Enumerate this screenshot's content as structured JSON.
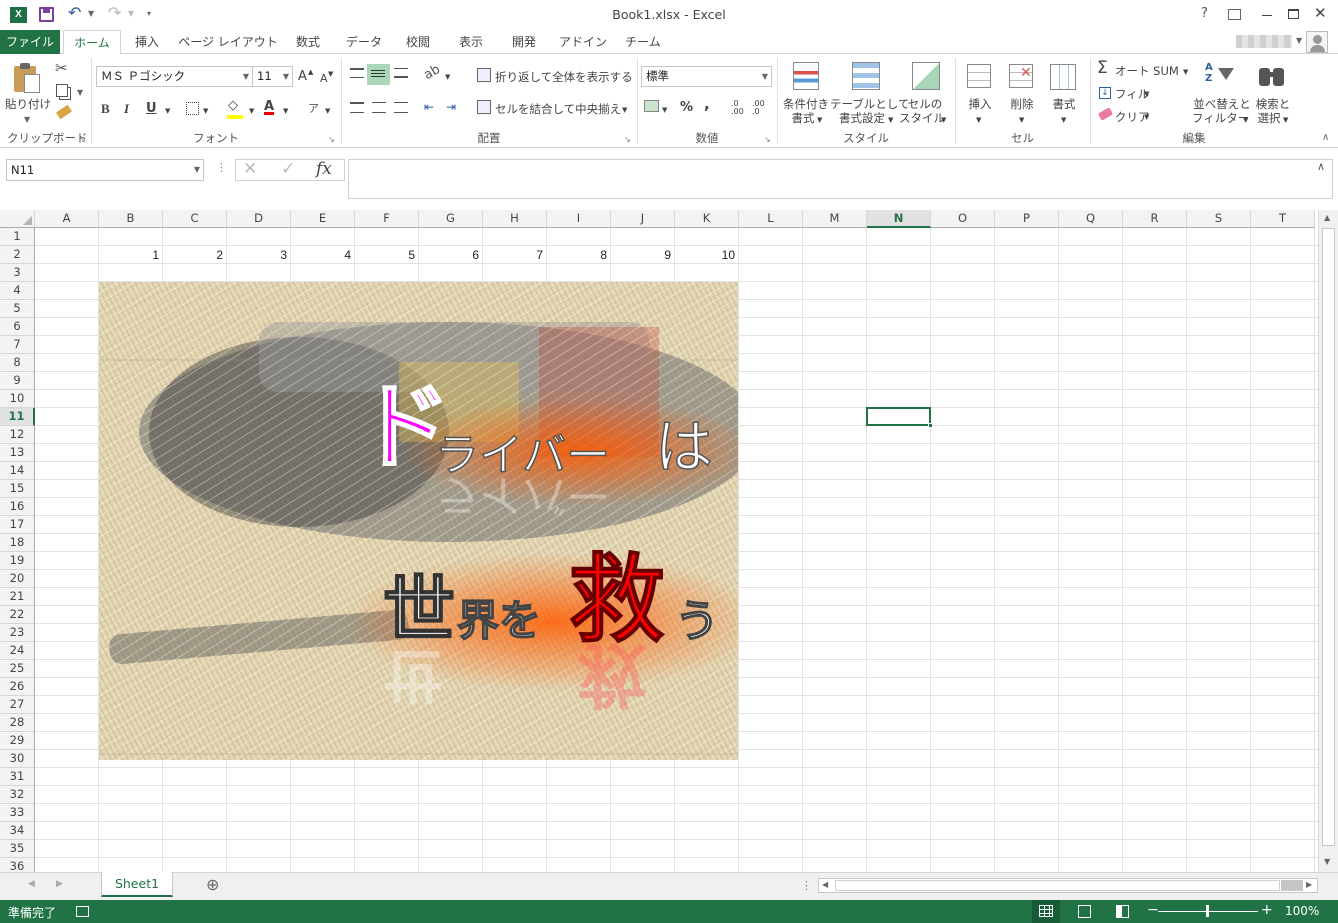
{
  "window": {
    "title": "Book1.xlsx - Excel",
    "help_label": "?"
  },
  "quick_access": {
    "app_icon": "excel-icon",
    "save_icon": "save-icon",
    "undo_icon": "undo-icon",
    "redo_icon": "redo-icon"
  },
  "tabs": [
    "ファイル",
    "ホーム",
    "挿入",
    "ページ レイアウト",
    "数式",
    "データ",
    "校閲",
    "表示",
    "開発",
    "アドイン",
    "チーム"
  ],
  "active_tab": "ホーム",
  "ribbon": {
    "clipboard": {
      "paste": "貼り付け",
      "label": "クリップボード"
    },
    "font": {
      "name": "ＭＳ Ｐゴシック",
      "size": "11",
      "bold": "B",
      "italic": "I",
      "underline": "U",
      "grow": "A",
      "shrink": "A",
      "font_color_letter": "A",
      "label": "フォント"
    },
    "alignment": {
      "wrap": "折り返して全体を表示する",
      "merge": "セルを結合して中央揃え",
      "label": "配置"
    },
    "number": {
      "format": "標準",
      "percent": "%",
      "comma": ",",
      "label": "数値"
    },
    "styles": {
      "conditional": [
        "条件付き",
        "書式"
      ],
      "table": [
        "テーブルとして",
        "書式設定"
      ],
      "cell": [
        "セルの",
        "スタイル"
      ],
      "label": "スタイル"
    },
    "cells": {
      "insert": "挿入",
      "delete": "削除",
      "format": "書式",
      "label": "セル"
    },
    "editing": {
      "autosum": "オート SUM",
      "fill": "フィル",
      "clear": "クリア",
      "sort": [
        "並べ替えと",
        "フィルター"
      ],
      "find": [
        "検索と",
        "選択"
      ],
      "label": "編集"
    }
  },
  "formula_bar": {
    "name_box": "N11",
    "cancel": "✕",
    "enter": "✓",
    "fx": "fx",
    "value": ""
  },
  "grid": {
    "columns": [
      "A",
      "B",
      "C",
      "D",
      "E",
      "F",
      "G",
      "H",
      "I",
      "J",
      "K",
      "L",
      "M",
      "N",
      "O",
      "P",
      "Q",
      "R",
      "S",
      "T"
    ],
    "rows": [
      "1",
      "2",
      "3",
      "4",
      "5",
      "6",
      "7",
      "8",
      "9",
      "10",
      "11",
      "12",
      "13",
      "14",
      "15",
      "16",
      "17",
      "18",
      "19",
      "20",
      "21",
      "22",
      "23",
      "24",
      "25",
      "26",
      "27",
      "28",
      "29",
      "30",
      "31",
      "32",
      "33",
      "34",
      "35",
      "36"
    ],
    "active_column": "N",
    "active_row": "11",
    "row2_values": [
      "1",
      "2",
      "3",
      "4",
      "5",
      "6",
      "7",
      "8",
      "9",
      "10"
    ]
  },
  "picture": {
    "line1_big": "ド",
    "line1_rest": "ライバー",
    "line1_end": "は",
    "line2_a": "世",
    "line2_b": "界を",
    "line2_c": "救",
    "line2_d": "う",
    "colors": {
      "magenta": "#ff00ff",
      "red": "#ff0000",
      "white": "#ffffff",
      "glow": "#ff6a00"
    }
  },
  "sheet_tabs": [
    "Sheet1"
  ],
  "add_sheet": "⊕",
  "status": {
    "ready": "準備完了",
    "zoom": "100%",
    "zoom_minus": "−",
    "zoom_plus": "+"
  },
  "accent_color": "#217346"
}
